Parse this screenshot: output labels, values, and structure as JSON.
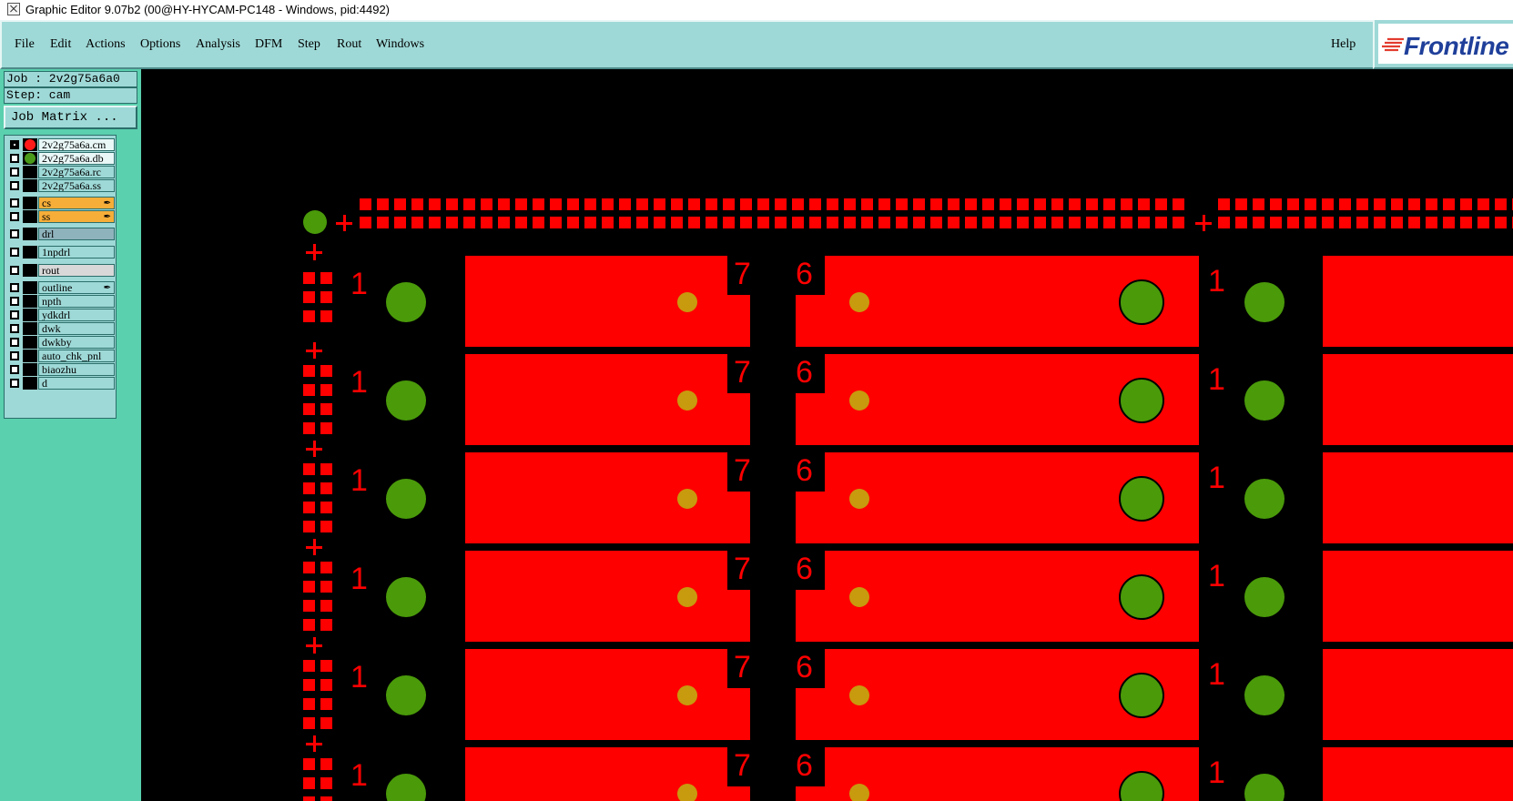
{
  "window": {
    "title": "Graphic Editor 9.07b2 (00@HY-HYCAM-PC148 - Windows, pid:4492)"
  },
  "menu": {
    "items": [
      {
        "label": "File"
      },
      {
        "label": "Edit"
      },
      {
        "label": "Actions"
      },
      {
        "label": "Options"
      },
      {
        "label": "Analysis"
      },
      {
        "label": "DFM"
      },
      {
        "label": "Step"
      },
      {
        "label": "Rout"
      },
      {
        "label": "Windows"
      }
    ],
    "help": "Help"
  },
  "logo": {
    "text": "Frontline"
  },
  "job": {
    "job_line": "Job : 2v2g75a6a0",
    "step_line": "Step: cam",
    "matrix_button": "Job Matrix ..."
  },
  "layers": [
    {
      "name": "2v2g75a6a.cm",
      "checked": true,
      "color": "#ff1a1a",
      "style": "sel"
    },
    {
      "name": "2v2g75a6a.db",
      "checked": false,
      "color": "#4a9a1a",
      "style": "sel"
    },
    {
      "name": "2v2g75a6a.rc",
      "checked": false,
      "color": "",
      "style": ""
    },
    {
      "name": "2v2g75a6a.ss",
      "checked": false,
      "color": "",
      "style": ""
    },
    {
      "name": "cs",
      "checked": false,
      "color": "",
      "style": "boardorange",
      "flag": true
    },
    {
      "name": "ss",
      "checked": false,
      "color": "",
      "style": "boardorange",
      "flag": true
    },
    {
      "name": "drl",
      "checked": false,
      "color": "",
      "style": "drl"
    },
    {
      "name": "1npdrl",
      "checked": false,
      "color": "",
      "style": ""
    },
    {
      "name": "rout",
      "checked": false,
      "color": "",
      "style": "rout"
    },
    {
      "name": "outline",
      "checked": false,
      "color": "",
      "style": "",
      "flag": true
    },
    {
      "name": "npth",
      "checked": false,
      "color": "",
      "style": ""
    },
    {
      "name": "ydkdrl",
      "checked": false,
      "color": "",
      "style": ""
    },
    {
      "name": "dwk",
      "checked": false,
      "color": "",
      "style": ""
    },
    {
      "name": "dwkby",
      "checked": false,
      "color": "",
      "style": ""
    },
    {
      "name": "auto_chk_pnl",
      "checked": false,
      "color": "",
      "style": ""
    },
    {
      "name": "biaozhu",
      "checked": false,
      "color": "",
      "style": ""
    },
    {
      "name": "d",
      "checked": false,
      "color": "",
      "style": ""
    }
  ],
  "canvas": {
    "colors": {
      "copper": "#ff0000",
      "pad": "#4a9a0a",
      "via": "#c89a0e",
      "background": "#000000"
    },
    "pad_labels": [
      "1",
      "7",
      "6",
      "1"
    ]
  }
}
